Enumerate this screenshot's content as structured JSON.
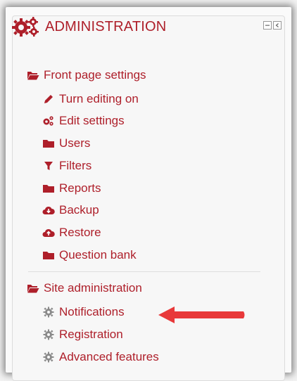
{
  "block": {
    "title": "ADMINISTRATION",
    "icon": "gears-icon"
  },
  "front_page": {
    "label": "Front page settings",
    "items": [
      {
        "label": "Turn editing on",
        "icon": "pencil-icon"
      },
      {
        "label": "Edit settings",
        "icon": "gears-icon"
      },
      {
        "label": "Users",
        "icon": "folder-icon"
      },
      {
        "label": "Filters",
        "icon": "filter-icon"
      },
      {
        "label": "Reports",
        "icon": "folder-icon"
      },
      {
        "label": "Backup",
        "icon": "cloud-download-icon"
      },
      {
        "label": "Restore",
        "icon": "cloud-upload-icon"
      },
      {
        "label": "Question bank",
        "icon": "folder-icon"
      }
    ]
  },
  "site_admin": {
    "label": "Site administration",
    "items": [
      {
        "label": "Notifications",
        "icon": "gear-icon"
      },
      {
        "label": "Registration",
        "icon": "gear-icon"
      },
      {
        "label": "Advanced features",
        "icon": "gear-icon"
      }
    ]
  },
  "colors": {
    "link": "#ae1f2a",
    "arrow": "#e8393a",
    "gear_grey": "#8a8a8a"
  }
}
